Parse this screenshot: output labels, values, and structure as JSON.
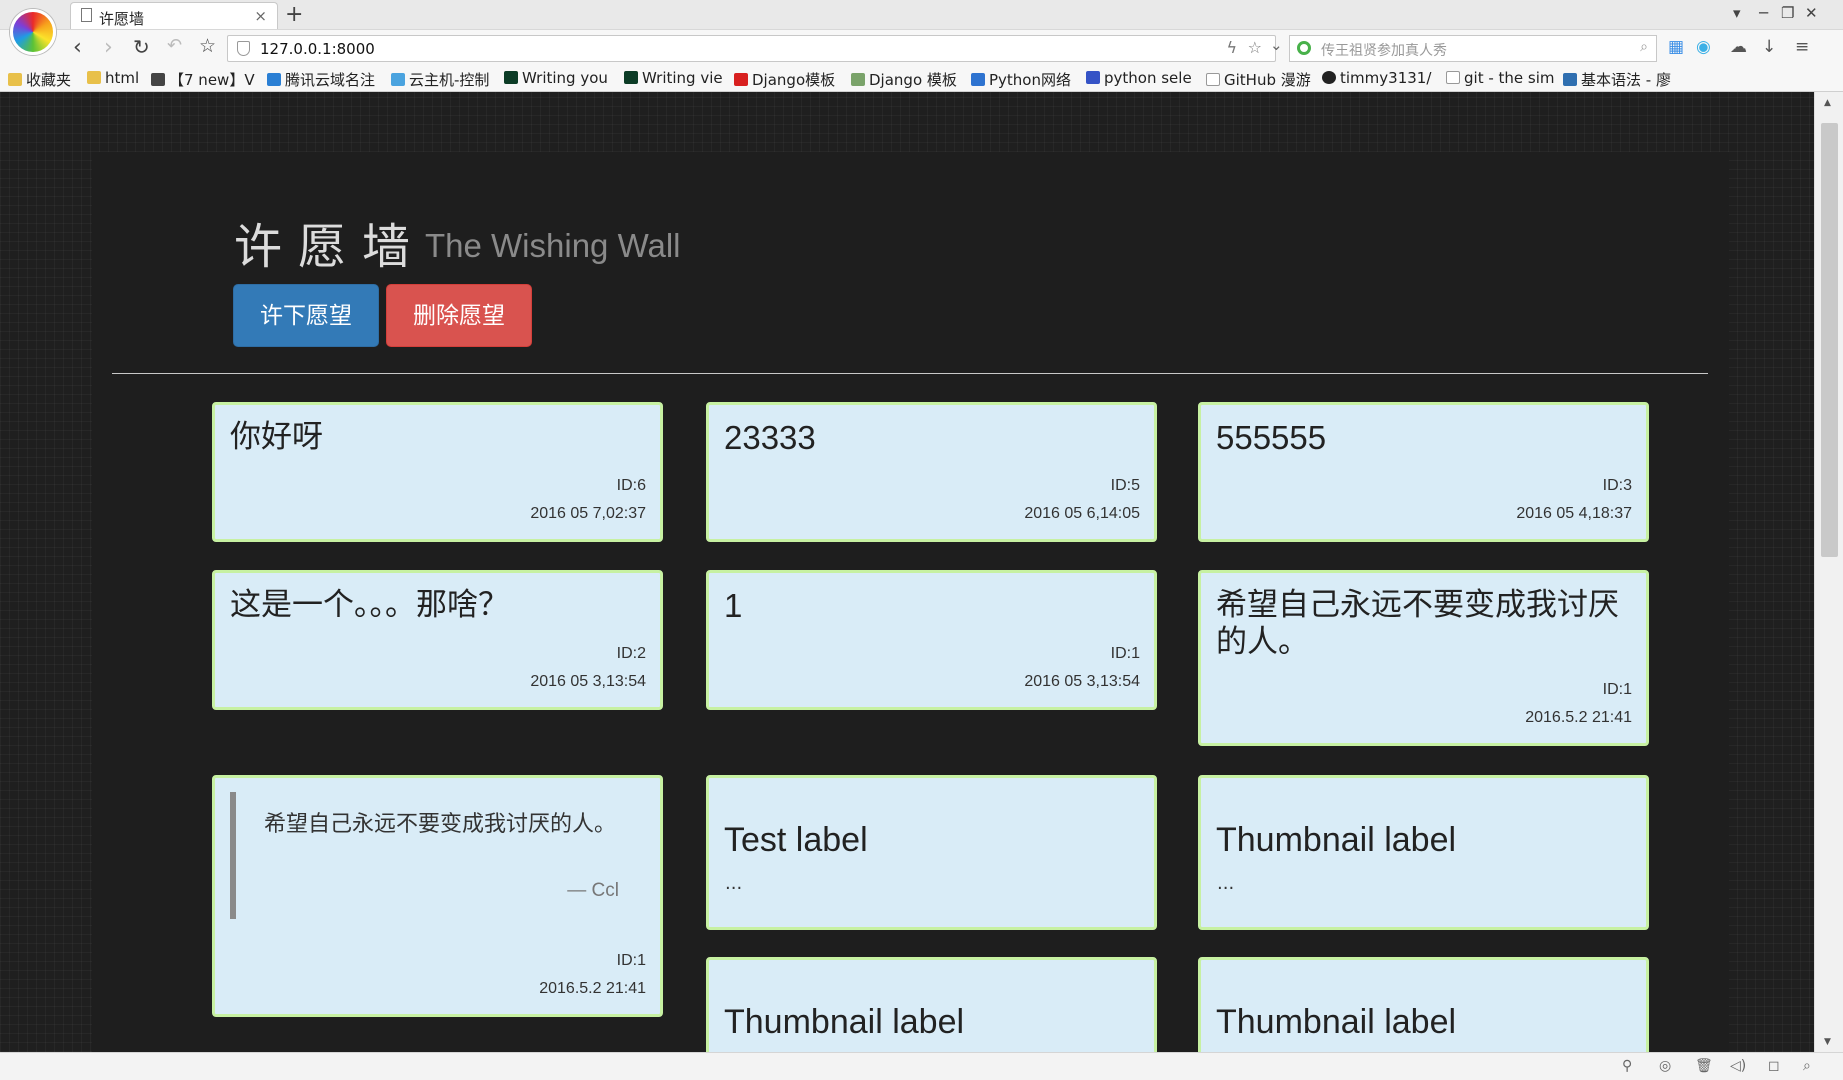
{
  "browser": {
    "tab_title": "许愿墙",
    "url": "127.0.0.1:8000",
    "search_placeholder": "传王祖贤参加真人秀",
    "bookmarks": [
      "收藏夹",
      "html",
      "【7 new】V",
      "腾讯云域名注",
      "云主机-控制",
      "Writing you",
      "Writing vie",
      "Django模板",
      "Django 模板",
      "Python网络",
      "python sele",
      "GitHub 漫游",
      "timmy3131/",
      "git - the sim",
      "基本语法 - 廖"
    ]
  },
  "header": {
    "title": "许愿墙",
    "subtitle": "The Wishing Wall",
    "make_wish_label": "许下愿望",
    "delete_wish_label": "删除愿望"
  },
  "wishes": [
    {
      "text": "你好呀",
      "id": "ID:6",
      "date": "2016 05 7,02:37"
    },
    {
      "text": "23333",
      "id": "ID:5",
      "date": "2016 05 6,14:05"
    },
    {
      "text": "555555",
      "id": "ID:3",
      "date": "2016 05 4,18:37"
    },
    {
      "text": "这是一个。。。那啥？",
      "id": "ID:2",
      "date": "2016 05 3,13:54"
    },
    {
      "text": "1",
      "id": "ID:1",
      "date": "2016 05 3,13:54"
    },
    {
      "text": "希望自己永远不要变成我讨厌的人。",
      "id": "ID:1",
      "date": "2016.5.2 21:41"
    }
  ],
  "quote_card": {
    "text": "希望自己永远不要变成我讨厌的人。",
    "source": "— Ccl",
    "id": "ID:1",
    "date": "2016.5.2 21:41"
  },
  "thumbnails": [
    {
      "label": "Test label",
      "dots": "..."
    },
    {
      "label": "Thumbnail label",
      "dots": "..."
    },
    {
      "label": "Thumbnail label"
    },
    {
      "label": "Thumbnail label"
    }
  ]
}
